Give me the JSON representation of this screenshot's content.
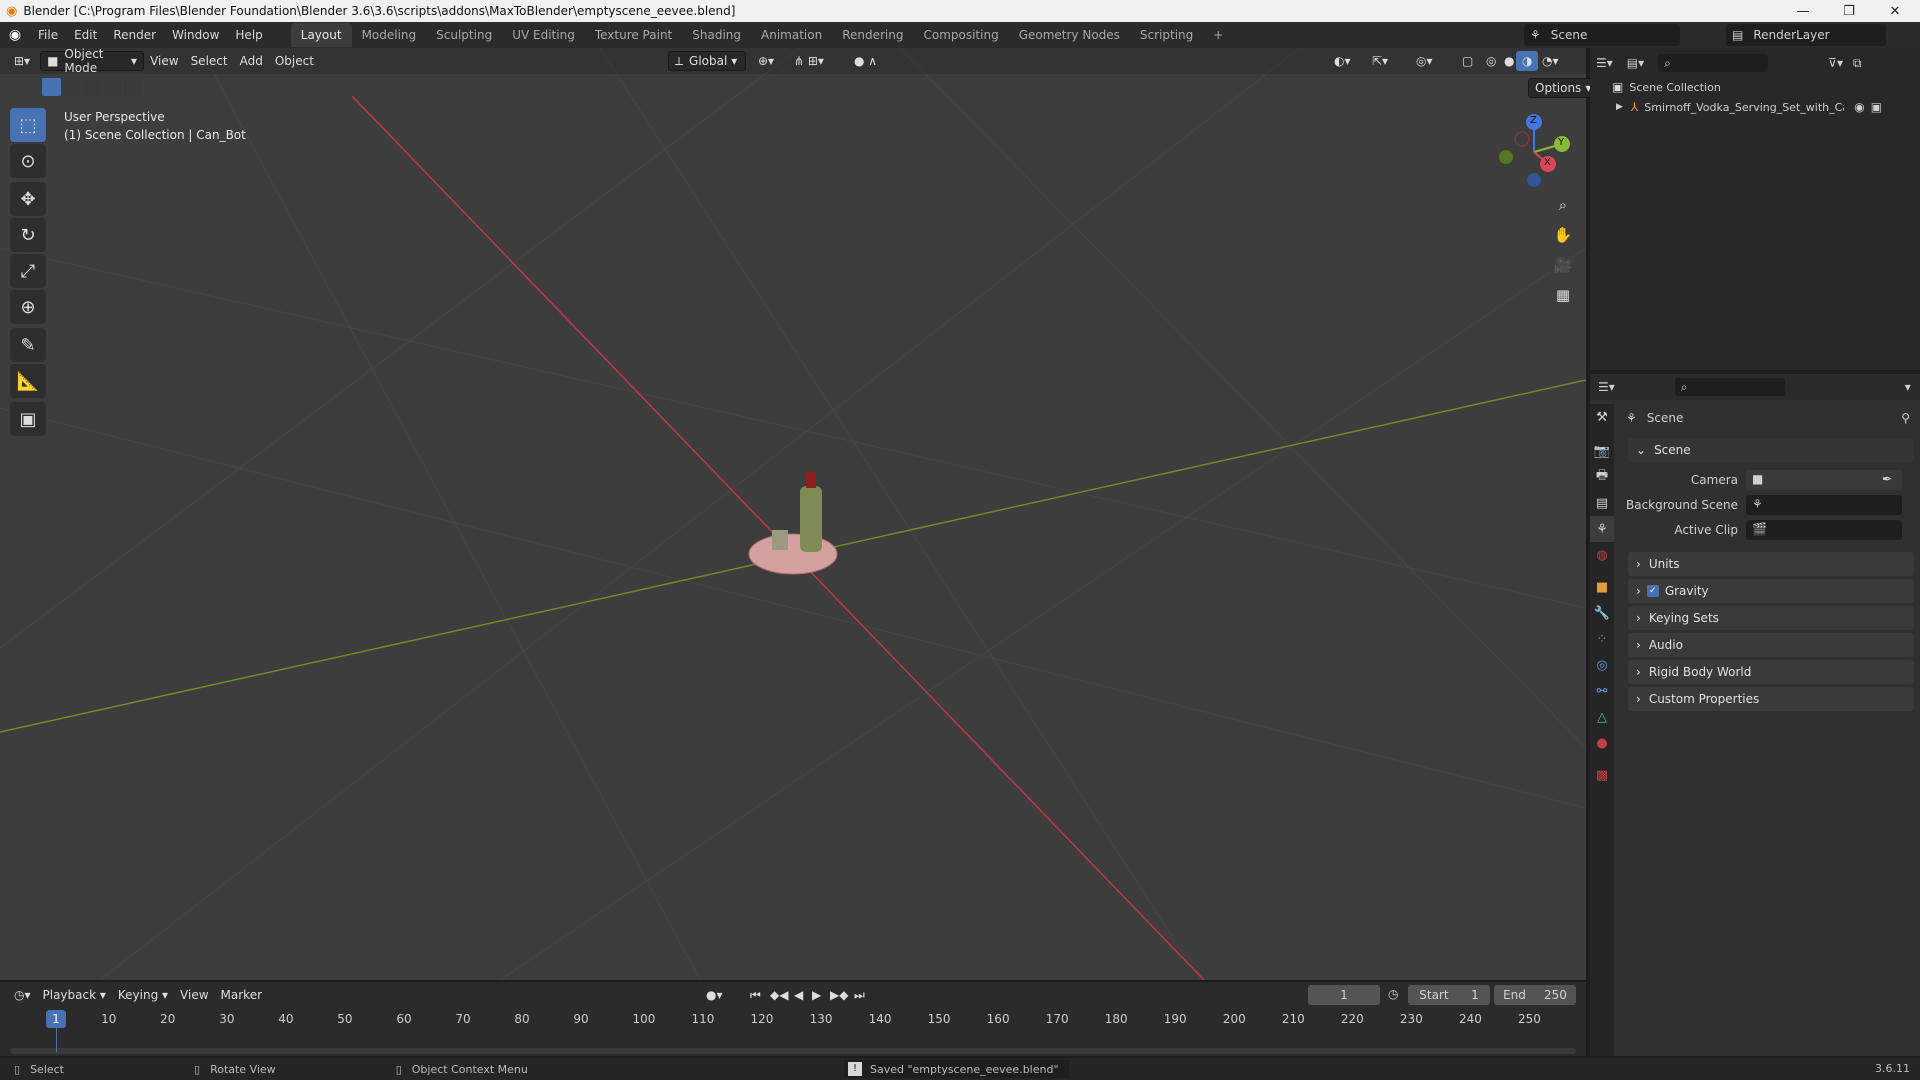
{
  "window": {
    "title": "Blender [C:\\Program Files\\Blender Foundation\\Blender 3.6\\3.6\\scripts\\addons\\MaxToBlender\\emptyscene_eevee.blend]",
    "minimize_icon": "minimize-icon",
    "maximize_icon": "restore-icon",
    "close_icon": "close-icon"
  },
  "menubar": {
    "items": [
      "File",
      "Edit",
      "Render",
      "Window",
      "Help"
    ],
    "workspaces": [
      "Layout",
      "Modeling",
      "Sculpting",
      "UV Editing",
      "Texture Paint",
      "Shading",
      "Animation",
      "Rendering",
      "Compositing",
      "Geometry Nodes",
      "Scripting"
    ],
    "active_workspace": "Layout",
    "scene_name": "Scene",
    "view_layer": "RenderLayer"
  },
  "viewport_header": {
    "mode": "Object Mode",
    "menus": [
      "View",
      "Select",
      "Add",
      "Object"
    ],
    "transform_orientation": "Global",
    "options_label": "Options"
  },
  "viewport": {
    "perspective_label": "User Perspective",
    "collection_label": "(1) Scene Collection | Can_Bot",
    "gizmo_axes": [
      "Z",
      "Y",
      "X"
    ],
    "colors": {
      "x_axis": "#c0393e",
      "y_axis": "#6b8e23",
      "background": "#3d3d3d",
      "grid": "#4a4a4a"
    }
  },
  "outliner": {
    "root": "Scene Collection",
    "items": [
      {
        "label": "Smirnoff_Vodka_Serving_Set_with_Cavi..."
      }
    ]
  },
  "properties": {
    "header": "Scene",
    "section_scene": "Scene",
    "fields": {
      "camera_label": "Camera",
      "background_label": "Background Scene",
      "clip_label": "Active Clip"
    },
    "panels": [
      "Units",
      "Gravity",
      "Keying Sets",
      "Audio",
      "Rigid Body World",
      "Custom Properties"
    ],
    "gravity_checked": true
  },
  "timeline": {
    "menus": [
      "Playback",
      "Keying",
      "View",
      "Marker"
    ],
    "current_frame": "1",
    "start_label": "Start",
    "start_value": "1",
    "end_label": "End",
    "end_value": "250",
    "ticks": [
      "1",
      "10",
      "20",
      "30",
      "40",
      "50",
      "60",
      "70",
      "80",
      "90",
      "100",
      "110",
      "120",
      "130",
      "140",
      "150",
      "160",
      "170",
      "180",
      "190",
      "200",
      "210",
      "220",
      "230",
      "240",
      "250"
    ]
  },
  "statusbar": {
    "select": "Select",
    "rotate": "Rotate View",
    "context": "Object Context Menu",
    "message": "Saved \"emptyscene_eevee.blend\"",
    "version": "3.6.11"
  }
}
